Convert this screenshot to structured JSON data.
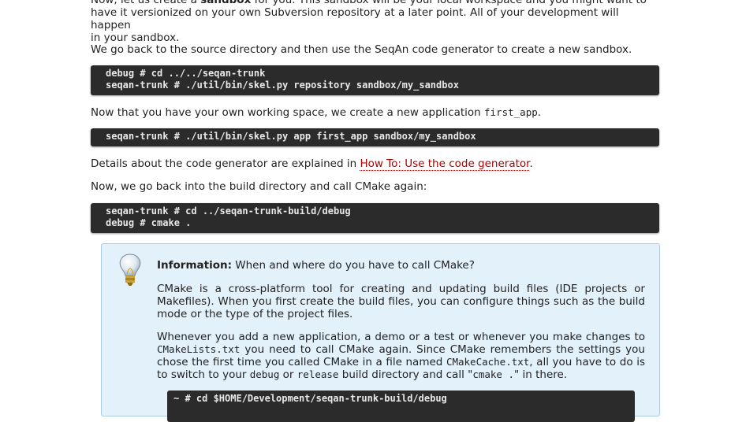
{
  "intro": {
    "line1_a": "Now, let us create a ",
    "line1_bold": "sandbox",
    "line1_b": " for you. This sandbox will be your local workspace and you might want to",
    "line2": "have it versionized on your own Subversion repository at a later point. All of your development will happen",
    "line3": "in your sandbox."
  },
  "p_go_back": "We go back to the source directory and then use the SeqAn code generator to create a new sandbox.",
  "code1": [
    "debug # cd ../../seqan-trunk",
    "seqan-trunk # ./util/bin/skel.py repository sandbox/my_sandbox"
  ],
  "p_workspace": {
    "text": "Now that you have your own working space, we create a new application ",
    "code": "first_app",
    "end": "."
  },
  "code2": [
    "seqan-trunk # ./util/bin/skel.py app first_app sandbox/my_sandbox"
  ],
  "p_details": {
    "text": "Details about the code generator are explained in ",
    "link": "How To: Use the code generator",
    "end": "."
  },
  "p_build": "Now, we go back into the build directory and call CMake again:",
  "code3": [
    "seqan-trunk # cd ../seqan-trunk-build/debug",
    "debug # cmake ."
  ],
  "info": {
    "title_bold": "Information:",
    "title_rest": " When and where do you have to call CMake?",
    "para1": "CMake is a cross-platform tool for creating and updating build files (IDE projects or Makefiles). When you first create the build files, you can configure things such as the build mode or the type of the project files.",
    "para2_a": "Whenever you add a new application, a demo or a test or whenever you make changes to ",
    "para2_code1": "CMakeLists.txt",
    "para2_b": " you need to call CMake again. Since CMake remembers the settings you chose the first time you called CMake in a file named ",
    "para2_code2": "CMakeCache.txt",
    "para2_c": ", all you have to do is to switch to your ",
    "para2_code3": "debug",
    "para2_d": " or ",
    "para2_code4": "release",
    "para2_e": " build directory and call \"",
    "para2_code5": "cmake .",
    "para2_f": "\" in there.",
    "code": "~ # cd $HOME/Development/seqan-trunk-build/debug"
  }
}
